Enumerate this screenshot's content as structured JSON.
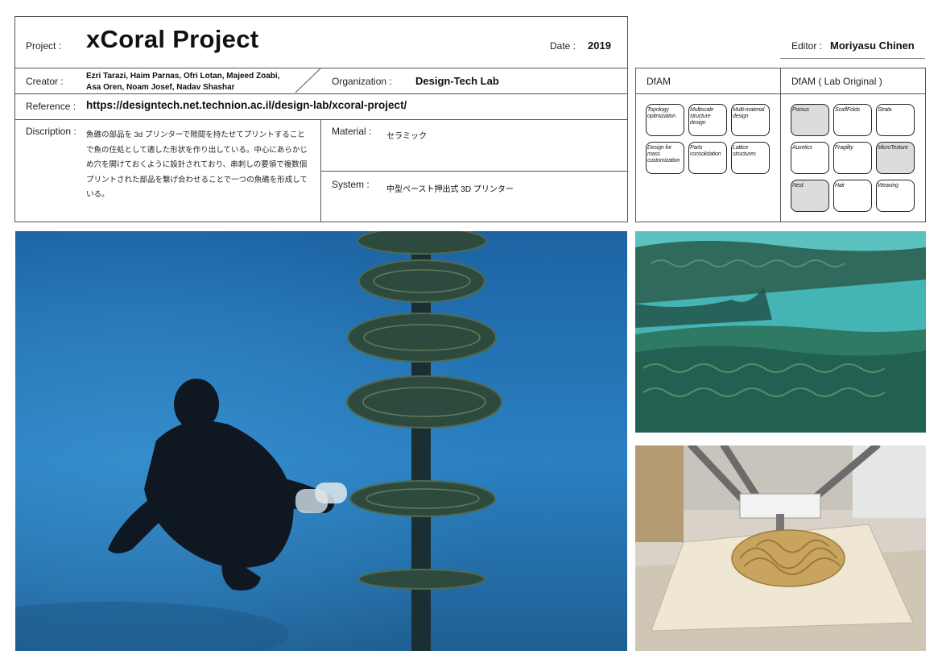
{
  "header": {
    "project_label": "Project :",
    "project_title": "xCoral Project",
    "date_label": "Date :",
    "date_value": "2019",
    "editor_label": "Editor :",
    "editor_name": "Moriyasu Chinen"
  },
  "creator": {
    "label": "Creator :",
    "line1": "Ezri Tarazi, Haim Parnas, Ofri Lotan, Majeed Zoabi,",
    "line2": "Asa Oren, Noam Josef, Nadav Shashar"
  },
  "organization": {
    "label": "Organization :",
    "value": "Design-Tech Lab"
  },
  "reference": {
    "label": "Reference :",
    "value": "https://designtech.net.technion.ac.il/design-lab/xcoral-project/"
  },
  "description": {
    "label": "Discription :",
    "lines": [
      "魚礁の部品を 3d プリンターで隙間を持たせてプリントすること",
      "で魚の住処として適した形状を作り出している。中心にあらかじ",
      "め穴を開けておくように設計されており、串刺しの要領で複数個",
      "プリントされた部品を繋げ合わせることで一つの魚礁を形成して",
      "いる。"
    ]
  },
  "material": {
    "label": "Material :",
    "value": "セラミック"
  },
  "system": {
    "label": "System :",
    "value": "中型ペースト押出式 3D プリンター"
  },
  "dfam": {
    "title": "DfAM",
    "items": [
      {
        "label": "Topology optimization",
        "active": false
      },
      {
        "label": "Multiscale structure design",
        "active": false
      },
      {
        "label": "Multi-material design",
        "active": false
      },
      {
        "label": "Design for mass customization",
        "active": false
      },
      {
        "label": "Parts consolidation",
        "active": false
      },
      {
        "label": "Lattice structures",
        "active": false
      }
    ]
  },
  "dfam_lab": {
    "title": "DfAM ( Lab Original )",
    "items": [
      {
        "label": "Porous",
        "active": true
      },
      {
        "label": "ScaffFolds",
        "active": false
      },
      {
        "label": "Strata",
        "active": false
      },
      {
        "label": "Auxetics",
        "active": false
      },
      {
        "label": "Fragility",
        "active": false
      },
      {
        "label": "MicroTexture",
        "active": true
      },
      {
        "label": "Nest",
        "active": true
      },
      {
        "label": "Hair",
        "active": false
      },
      {
        "label": "Weaving",
        "active": false
      }
    ]
  },
  "colors": {
    "water": "#1f6aa6",
    "water_light": "#2d8bc9",
    "teal": "#2aa3a3",
    "clay": "#c8a45e",
    "chip_active": "#dcdcdc"
  }
}
